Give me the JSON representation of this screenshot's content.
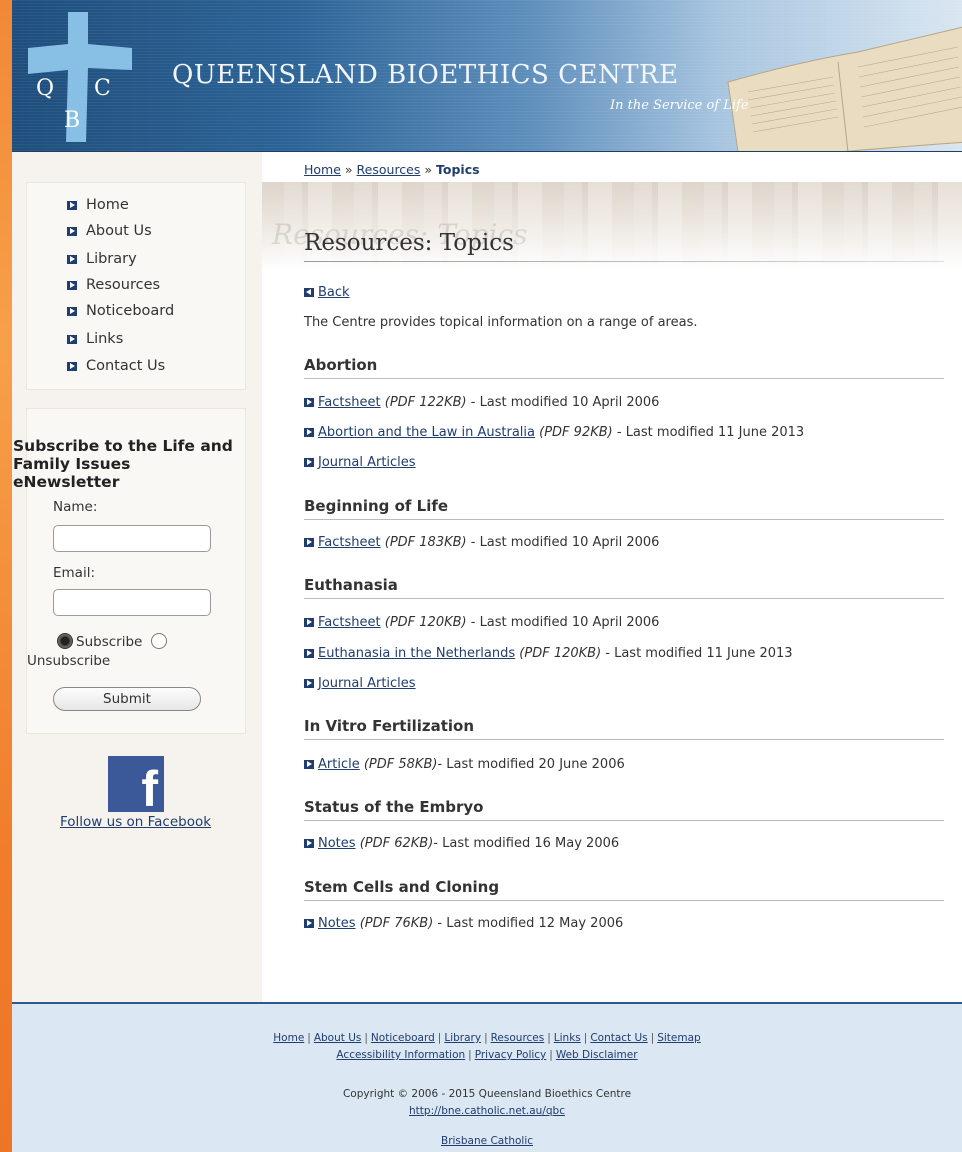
{
  "header": {
    "logo_letters": [
      "Q",
      "C",
      "B"
    ],
    "title": "Queensland Bioethics Centre",
    "tagline": "In the Service of Life"
  },
  "nav": {
    "items": [
      {
        "label": "Home"
      },
      {
        "label": "About Us"
      },
      {
        "label": "Library"
      },
      {
        "label": "Resources"
      },
      {
        "label": "Noticeboard"
      },
      {
        "label": "Links"
      },
      {
        "label": "Contact Us"
      }
    ]
  },
  "subscribe": {
    "title": "Subscribe to the Life and Family Issues eNewsletter",
    "name_label": "Name:",
    "name_value": "",
    "email_label": "Email:",
    "email_value": "",
    "subscribe_label": "Subscribe",
    "unsubscribe_label": "Unsubscribe",
    "selected": "Subscribe",
    "submit_label": "Submit"
  },
  "facebook": {
    "icon_glyph": "f",
    "link_label": "Follow us on Facebook"
  },
  "breadcrumb": {
    "home": "Home",
    "sep": "»",
    "resources": "Resources",
    "current": "Topics"
  },
  "page": {
    "banner_ghost": "Resources: Topics",
    "title": "Resources: Topics",
    "back_label": "Back",
    "intro": "The Centre provides topical information on a range of areas."
  },
  "sections": [
    {
      "heading": "Abortion",
      "items": [
        {
          "link": "Factsheet",
          "meta": "(PDF 122KB)",
          "modified": " - Last modified 10 April 2006"
        },
        {
          "link": "Abortion and the Law in Australia",
          "meta": "(PDF 92KB)",
          "modified": " - Last modified 11 June 2013"
        },
        {
          "link": "Journal Articles",
          "meta": "",
          "modified": ""
        }
      ]
    },
    {
      "heading": "Beginning of Life",
      "items": [
        {
          "link": "Factsheet",
          "meta": "(PDF 183KB)",
          "modified": " - Last modified 10 April 2006"
        }
      ]
    },
    {
      "heading": "Euthanasia",
      "items": [
        {
          "link": "Factsheet",
          "meta": "(PDF 120KB)",
          "modified": " - Last modified 10 April 2006"
        },
        {
          "link": "Euthanasia in the Netherlands",
          "meta": "(PDF 120KB)",
          "modified": " - Last modified 11 June 2013"
        },
        {
          "link": "Journal Articles",
          "meta": "",
          "modified": ""
        }
      ]
    },
    {
      "heading": "In Vitro Fertilization",
      "items": [
        {
          "link": "Article",
          "meta": "(PDF 58KB)",
          "modified": "- Last modified 20 June 2006"
        }
      ]
    },
    {
      "heading": "Status of the Embryo",
      "items": [
        {
          "link": "Notes",
          "meta": "(PDF 62KB)",
          "modified": "- Last modified 16 May 2006"
        }
      ]
    },
    {
      "heading": "Stem Cells and Cloning",
      "items": [
        {
          "link": "Notes",
          "meta": "(PDF 76KB)",
          "modified": " - Last modified 12 May 2006"
        }
      ]
    }
  ],
  "footer": {
    "links_row1": [
      "Home",
      "About Us",
      "Noticeboard",
      "Library",
      "Resources",
      "Links",
      "Contact Us",
      "Sitemap"
    ],
    "links_row2": [
      "Accessibility Information",
      "Privacy Policy",
      "Web Disclaimer"
    ],
    "separator": "|",
    "copyright": "Copyright © 2006 - 2015 Queensland Bioethics Centre",
    "url": "http://bne.catholic.net.au/qbc",
    "org": "Brisbane Catholic"
  },
  "colors": {
    "accent": "#1f3d6e",
    "page_background": "#f07a2a",
    "header_blue": "#2c6497",
    "footer_bg": "#dbe7f2",
    "facebook_blue": "#3b5998"
  }
}
